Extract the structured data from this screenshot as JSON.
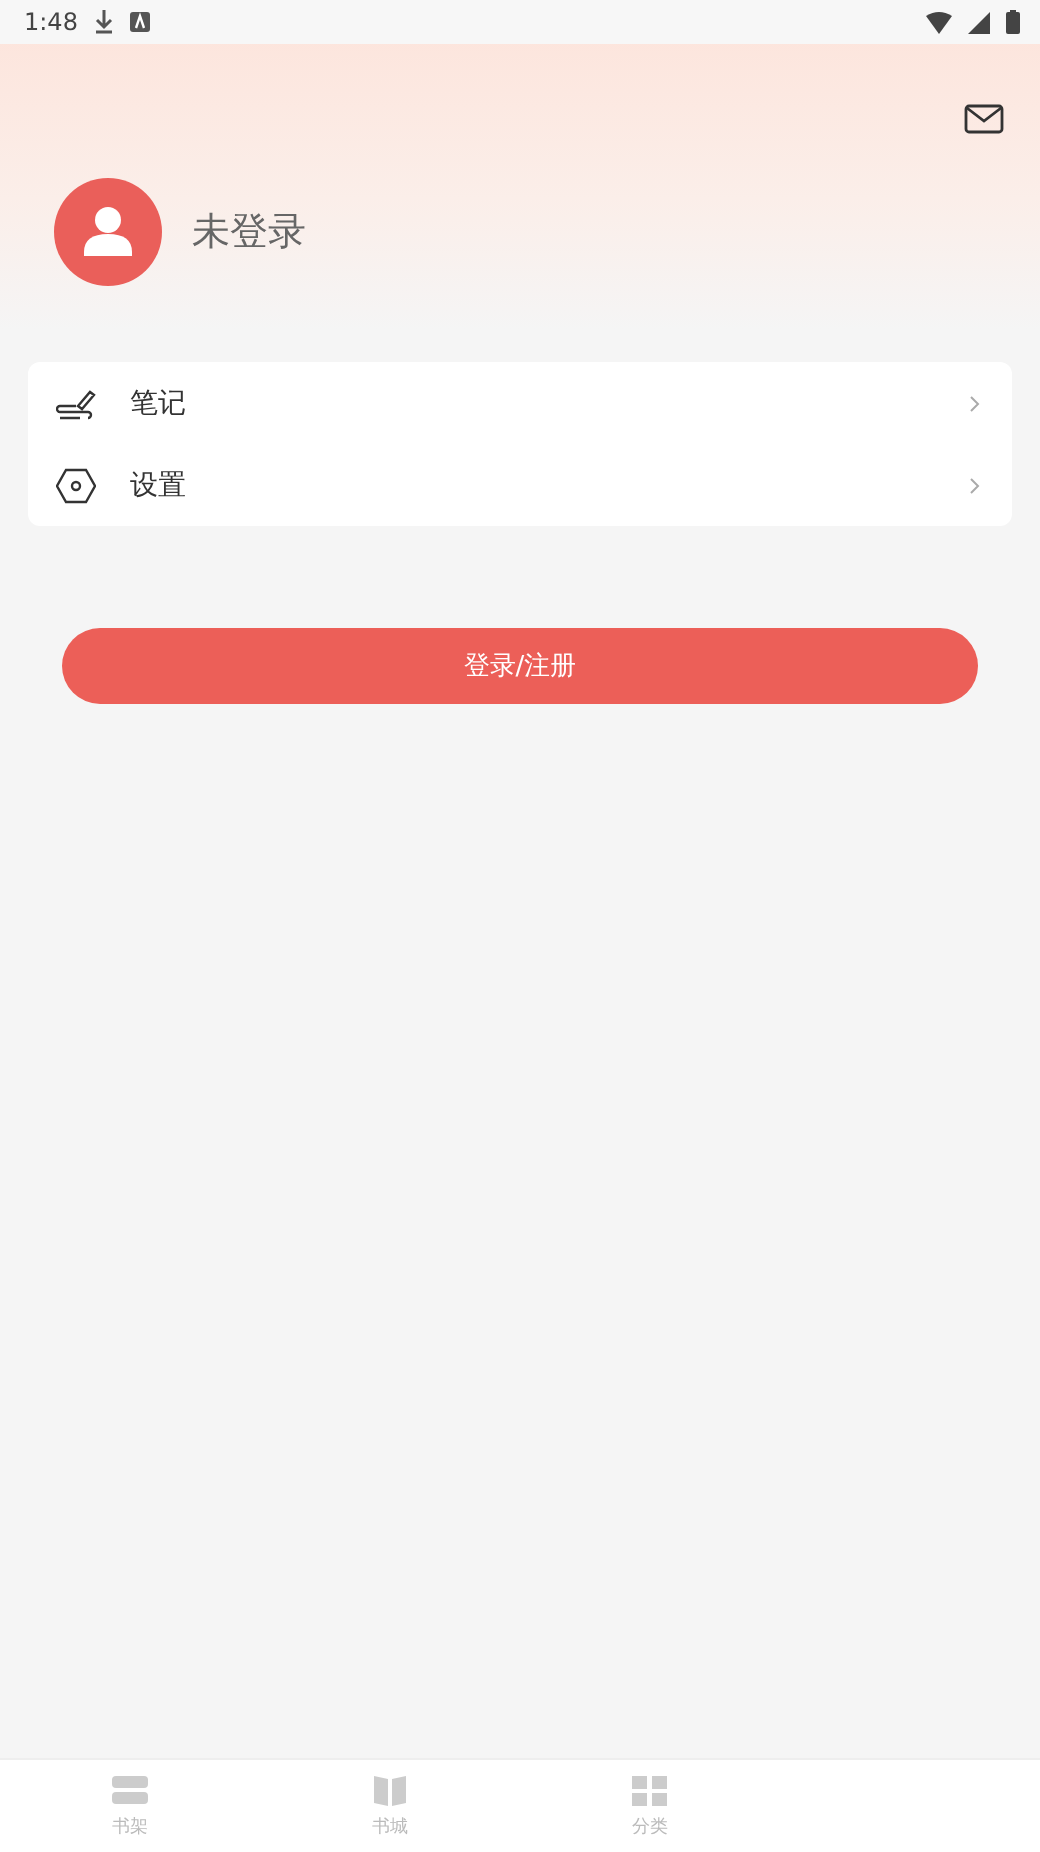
{
  "status_bar": {
    "time": "1:48"
  },
  "profile": {
    "name": "未登录"
  },
  "menu": [
    {
      "kind": "note",
      "label": "笔记"
    },
    {
      "kind": "settings",
      "label": "设置"
    }
  ],
  "login_button": "登录/注册",
  "bottom_nav": [
    {
      "kind": "shelf",
      "label": "书架",
      "selected": false
    },
    {
      "kind": "store",
      "label": "书城",
      "selected": false
    },
    {
      "kind": "category",
      "label": "分类",
      "selected": false
    }
  ]
}
